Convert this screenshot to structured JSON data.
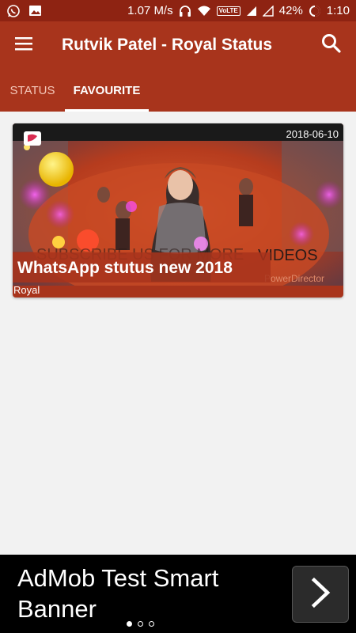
{
  "status_bar": {
    "left_icons": [
      "whatsapp-icon",
      "image-icon"
    ],
    "network_speed": "1.07 M/s",
    "volte": "VoLTE",
    "battery": "42%",
    "time": "1:10"
  },
  "app_bar": {
    "title": "Rutvik Patel - Royal Status",
    "menu_icon": "hamburger-menu-icon",
    "search_icon": "search-icon"
  },
  "tabs": [
    {
      "label": "STATUS",
      "selected": false
    },
    {
      "label": "FAVOURITE",
      "selected": true
    }
  ],
  "cards": [
    {
      "date": "2018-06-10",
      "title": "WhatsApp stutus new 2018",
      "category": "Royal"
    }
  ],
  "ad": {
    "text": "AdMob Test Smart Banner",
    "button_icon": "chevron-right-icon",
    "page_count": 3,
    "active_page": 1
  },
  "colors": {
    "status_bar": "#8e2312",
    "primary": "#a8341c",
    "background": "#f2f2f2",
    "ad_background": "#000000"
  }
}
